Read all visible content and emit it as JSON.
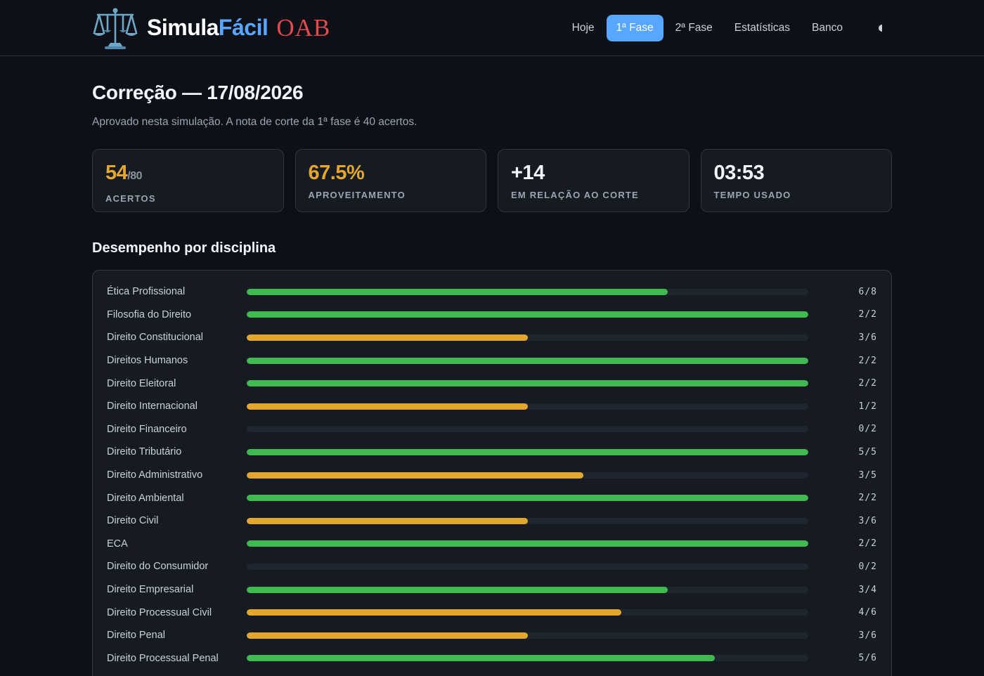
{
  "brand": {
    "part1": "Simula",
    "part2": "Fácil",
    "part3": "OAB"
  },
  "nav": [
    {
      "label": "Hoje",
      "active": false
    },
    {
      "label": "1ª Fase",
      "active": true
    },
    {
      "label": "2ª Fase",
      "active": false
    },
    {
      "label": "Estatísticas",
      "active": false
    },
    {
      "label": "Banco",
      "active": false
    }
  ],
  "page": {
    "title": "Correção — 17/08/2026",
    "subtitle": "Aprovado nesta simulação. A nota de corte da 1ª fase é 40 acertos."
  },
  "stats": {
    "acertos": {
      "value": "54",
      "total": "/80",
      "label": "ACERTOS"
    },
    "aproveitamento": {
      "value": "67.5%",
      "label": "APROVEITAMENTO"
    },
    "corte": {
      "value": "+14",
      "label": "EM RELAÇÃO AO CORTE"
    },
    "tempo": {
      "value": "03:53",
      "label": "TEMPO USADO"
    }
  },
  "section_title": "Desempenho por disciplina",
  "colors": {
    "green": "#3fb950",
    "gold": "#e3a72f",
    "accent": "#58a6ff",
    "red": "#e5484d"
  },
  "disciplinas": [
    {
      "name": "Ética Profissional",
      "correct": 6,
      "total": 8,
      "count": "6/8"
    },
    {
      "name": "Filosofia do Direito",
      "correct": 2,
      "total": 2,
      "count": "2/2"
    },
    {
      "name": "Direito Constitucional",
      "correct": 3,
      "total": 6,
      "count": "3/6"
    },
    {
      "name": "Direitos Humanos",
      "correct": 2,
      "total": 2,
      "count": "2/2"
    },
    {
      "name": "Direito Eleitoral",
      "correct": 2,
      "total": 2,
      "count": "2/2"
    },
    {
      "name": "Direito Internacional",
      "correct": 1,
      "total": 2,
      "count": "1/2"
    },
    {
      "name": "Direito Financeiro",
      "correct": 0,
      "total": 2,
      "count": "0/2"
    },
    {
      "name": "Direito Tributário",
      "correct": 5,
      "total": 5,
      "count": "5/5"
    },
    {
      "name": "Direito Administrativo",
      "correct": 3,
      "total": 5,
      "count": "3/5"
    },
    {
      "name": "Direito Ambiental",
      "correct": 2,
      "total": 2,
      "count": "2/2"
    },
    {
      "name": "Direito Civil",
      "correct": 3,
      "total": 6,
      "count": "3/6"
    },
    {
      "name": "ECA",
      "correct": 2,
      "total": 2,
      "count": "2/2"
    },
    {
      "name": "Direito do Consumidor",
      "correct": 0,
      "total": 2,
      "count": "0/2"
    },
    {
      "name": "Direito Empresarial",
      "correct": 3,
      "total": 4,
      "count": "3/4"
    },
    {
      "name": "Direito Processual Civil",
      "correct": 4,
      "total": 6,
      "count": "4/6"
    },
    {
      "name": "Direito Penal",
      "correct": 3,
      "total": 6,
      "count": "3/6"
    },
    {
      "name": "Direito Processual Penal",
      "correct": 5,
      "total": 6,
      "count": "5/6"
    }
  ]
}
